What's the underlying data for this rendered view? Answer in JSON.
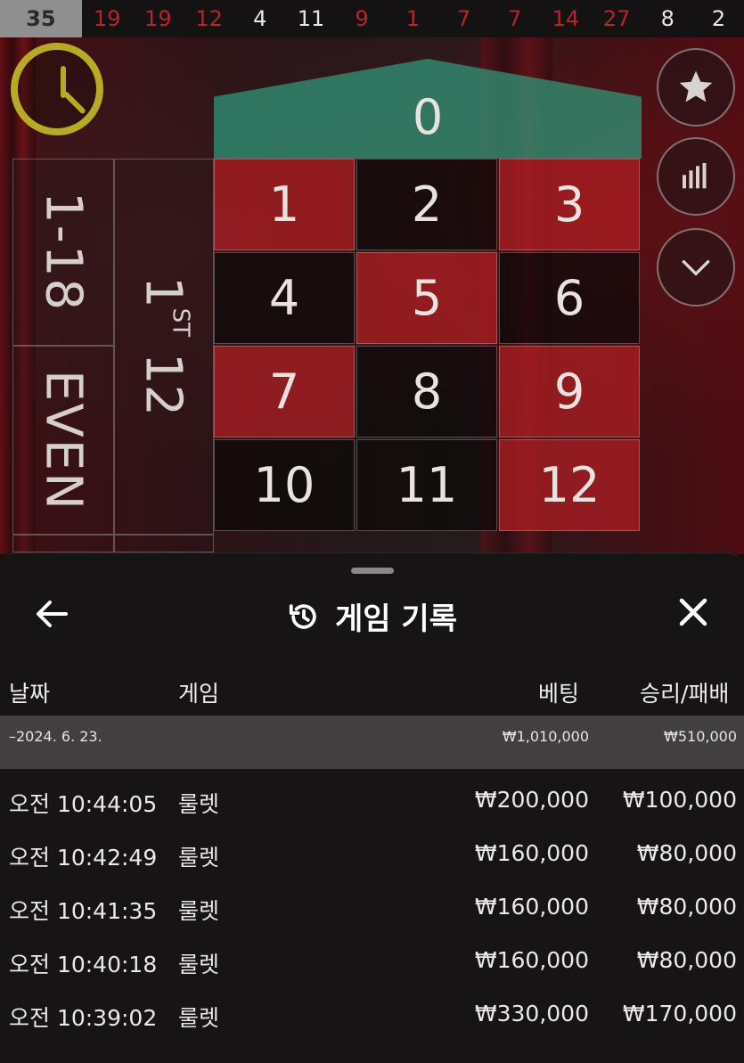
{
  "results": {
    "current": "35",
    "items": [
      {
        "value": "19",
        "color": "red"
      },
      {
        "value": "19",
        "color": "red"
      },
      {
        "value": "12",
        "color": "red"
      },
      {
        "value": "4",
        "color": "black"
      },
      {
        "value": "11",
        "color": "black"
      },
      {
        "value": "9",
        "color": "red"
      },
      {
        "value": "1",
        "color": "red"
      },
      {
        "value": "7",
        "color": "red"
      },
      {
        "value": "7",
        "color": "red"
      },
      {
        "value": "14",
        "color": "red"
      },
      {
        "value": "27",
        "color": "red"
      },
      {
        "value": "8",
        "color": "black"
      },
      {
        "value": "2",
        "color": "black"
      }
    ]
  },
  "table": {
    "zero": "0",
    "numbers": [
      "1",
      "2",
      "3",
      "4",
      "5",
      "6",
      "7",
      "8",
      "9",
      "10",
      "11",
      "12"
    ],
    "low": "1-18",
    "even": "EVEN",
    "dozen_num": "1",
    "dozen_sup": "ST",
    "dozen_tail": " 12"
  },
  "sheet": {
    "title": "게임 기록",
    "columns": {
      "date": "날짜",
      "game": "게임",
      "bet": "베팅",
      "winloss": "승리/패배"
    },
    "date_group": {
      "date": "–2024. 6. 23.",
      "bet": "₩1,010,000",
      "winloss": "₩510,000"
    },
    "rows": [
      {
        "time": "오전 10:44:05",
        "game": "룰렛",
        "bet": "₩200,000",
        "winloss": "₩100,000"
      },
      {
        "time": "오전 10:42:49",
        "game": "룰렛",
        "bet": "₩160,000",
        "winloss": "₩80,000"
      },
      {
        "time": "오전 10:41:35",
        "game": "룰렛",
        "bet": "₩160,000",
        "winloss": "₩80,000"
      },
      {
        "time": "오전 10:40:18",
        "game": "룰렛",
        "bet": "₩160,000",
        "winloss": "₩80,000"
      },
      {
        "time": "오전 10:39:02",
        "game": "룰렛",
        "bet": "₩330,000",
        "winloss": "₩170,000"
      }
    ]
  },
  "icons": [
    "clock-icon",
    "star-icon",
    "stats-icon",
    "chevron-down-icon",
    "back-arrow-icon",
    "history-icon",
    "close-icon"
  ],
  "colors": {
    "red": "#b9242a",
    "green_zero": "#309678",
    "timer": "#b7ab25"
  }
}
